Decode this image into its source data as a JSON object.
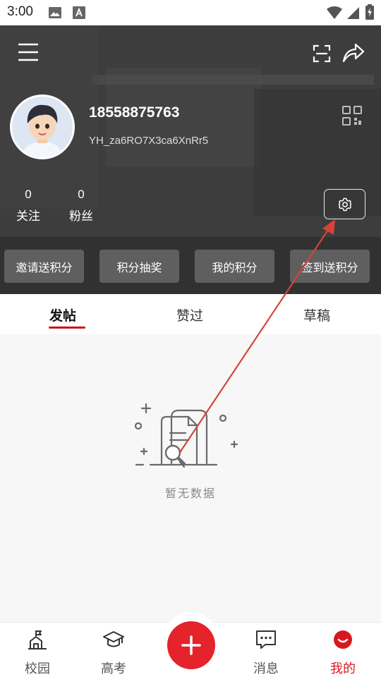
{
  "status_bar": {
    "time": "3:00"
  },
  "profile": {
    "phone": "18558875763",
    "user_id": "YH_za6RO7X3ca6XnRr5",
    "stats": [
      {
        "value": "0",
        "label": "关注"
      },
      {
        "value": "0",
        "label": "粉丝"
      }
    ]
  },
  "actions": [
    {
      "label": "邀请送积分"
    },
    {
      "label": "积分抽奖"
    },
    {
      "label": "我的积分"
    },
    {
      "label": "签到送积分"
    }
  ],
  "tabs": [
    {
      "label": "发帖",
      "active": true
    },
    {
      "label": "赞过",
      "active": false
    },
    {
      "label": "草稿",
      "active": false
    }
  ],
  "empty_state": {
    "text": "暂无数据"
  },
  "bottom_nav": [
    {
      "label": "校园",
      "icon": "campus-icon"
    },
    {
      "label": "高考",
      "icon": "graduation-cap-icon"
    },
    {
      "label": "",
      "icon": "plus-icon"
    },
    {
      "label": "消息",
      "icon": "message-icon"
    },
    {
      "label": "我的",
      "icon": "profile-icon",
      "active": true
    }
  ],
  "colors": {
    "accent": "#d7191f",
    "header_bg": "#3a3a3a",
    "action_pill": "#5f5f5f",
    "annotation_arrow": "#d9413a"
  }
}
